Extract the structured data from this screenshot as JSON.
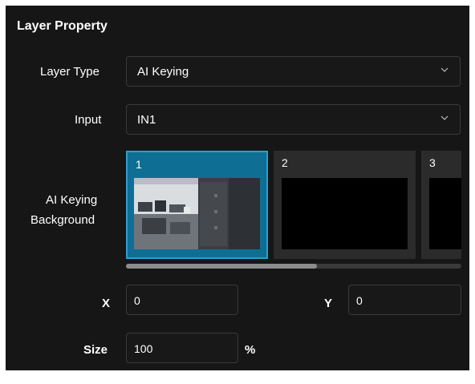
{
  "panel": {
    "title": "Layer Property"
  },
  "layer_type": {
    "label": "Layer Type",
    "value": "AI Keying",
    "icon": "chevron-down-icon"
  },
  "input": {
    "label": "Input",
    "value": "IN1",
    "icon": "chevron-down-icon"
  },
  "background": {
    "label_line1": "AI Keying",
    "label_line2": "Background",
    "thumbnails": [
      {
        "num": "1",
        "selected": true
      },
      {
        "num": "2",
        "selected": false
      },
      {
        "num": "3",
        "selected": false
      }
    ]
  },
  "position": {
    "x_label": "X",
    "x_value": "0",
    "y_label": "Y",
    "y_value": "0"
  },
  "size": {
    "label": "Size",
    "value": "100",
    "unit": "%"
  },
  "colors": {
    "panel_bg": "#161616",
    "selected_bg": "#0f6e93",
    "selected_border": "#2a9fd0"
  }
}
